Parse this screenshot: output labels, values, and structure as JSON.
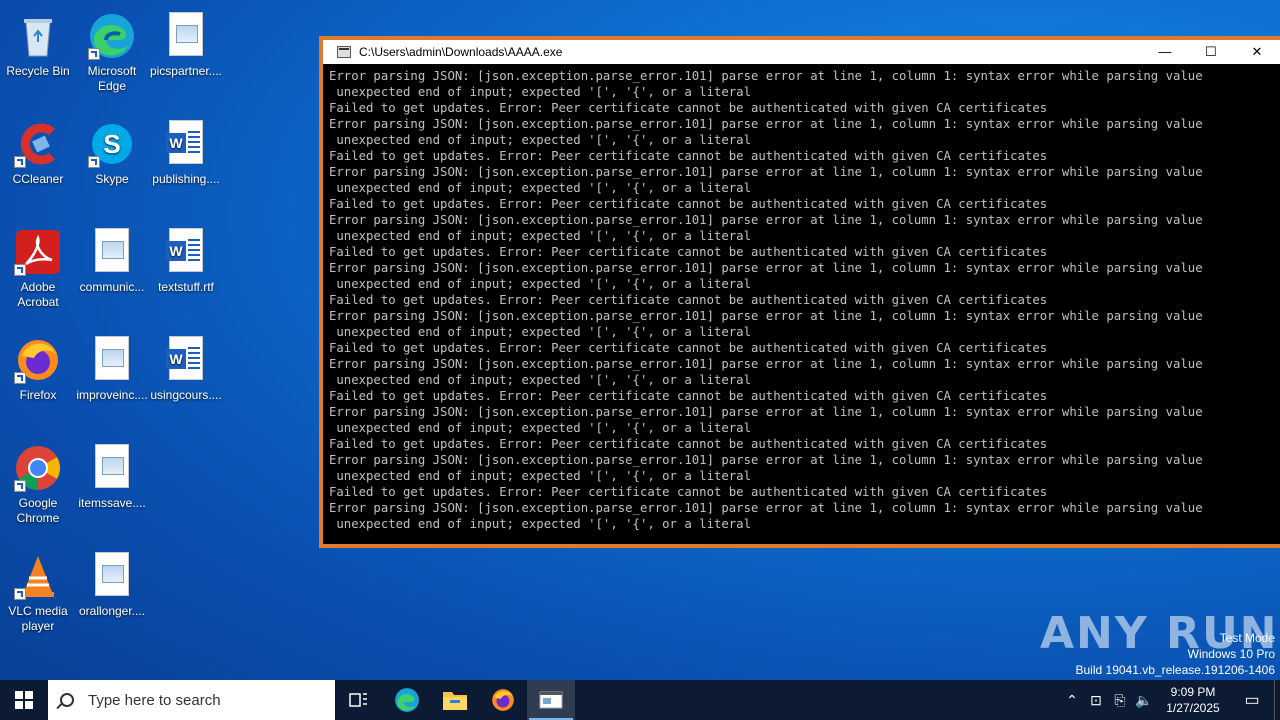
{
  "desktop": {
    "icons": [
      {
        "label": "Recycle Bin"
      },
      {
        "label": "Microsoft Edge"
      },
      {
        "label": "picspartner...."
      },
      {
        "label": "CCleaner"
      },
      {
        "label": "Skype"
      },
      {
        "label": "publishing...."
      },
      {
        "label": "Adobe Acrobat"
      },
      {
        "label": "communic..."
      },
      {
        "label": "textstuff.rtf"
      },
      {
        "label": "Firefox"
      },
      {
        "label": "improveinc...."
      },
      {
        "label": "usingcours...."
      },
      {
        "label": "Google Chrome"
      },
      {
        "label": "itemssave...."
      },
      {
        "label": "VLC media player"
      },
      {
        "label": "orallonger...."
      }
    ]
  },
  "console": {
    "title": "C:\\Users\\admin\\Downloads\\AAAA.exe",
    "minimize": "—",
    "maximize": "☐",
    "close": "✕",
    "lines": [
      "Error parsing JSON: [json.exception.parse_error.101] parse error at line 1, column 1: syntax error while parsing value",
      " unexpected end of input; expected '[', '{', or a literal",
      "Failed to get updates. Error: Peer certificate cannot be authenticated with given CA certificates",
      "Error parsing JSON: [json.exception.parse_error.101] parse error at line 1, column 1: syntax error while parsing value",
      " unexpected end of input; expected '[', '{', or a literal",
      "Failed to get updates. Error: Peer certificate cannot be authenticated with given CA certificates",
      "Error parsing JSON: [json.exception.parse_error.101] parse error at line 1, column 1: syntax error while parsing value",
      " unexpected end of input; expected '[', '{', or a literal",
      "Failed to get updates. Error: Peer certificate cannot be authenticated with given CA certificates",
      "Error parsing JSON: [json.exception.parse_error.101] parse error at line 1, column 1: syntax error while parsing value",
      " unexpected end of input; expected '[', '{', or a literal",
      "Failed to get updates. Error: Peer certificate cannot be authenticated with given CA certificates",
      "Error parsing JSON: [json.exception.parse_error.101] parse error at line 1, column 1: syntax error while parsing value",
      " unexpected end of input; expected '[', '{', or a literal",
      "Failed to get updates. Error: Peer certificate cannot be authenticated with given CA certificates",
      "Error parsing JSON: [json.exception.parse_error.101] parse error at line 1, column 1: syntax error while parsing value",
      " unexpected end of input; expected '[', '{', or a literal",
      "Failed to get updates. Error: Peer certificate cannot be authenticated with given CA certificates",
      "Error parsing JSON: [json.exception.parse_error.101] parse error at line 1, column 1: syntax error while parsing value",
      " unexpected end of input; expected '[', '{', or a literal",
      "Failed to get updates. Error: Peer certificate cannot be authenticated with given CA certificates",
      "Error parsing JSON: [json.exception.parse_error.101] parse error at line 1, column 1: syntax error while parsing value",
      " unexpected end of input; expected '[', '{', or a literal",
      "Failed to get updates. Error: Peer certificate cannot be authenticated with given CA certificates",
      "Error parsing JSON: [json.exception.parse_error.101] parse error at line 1, column 1: syntax error while parsing value",
      " unexpected end of input; expected '[', '{', or a literal",
      "Failed to get updates. Error: Peer certificate cannot be authenticated with given CA certificates",
      "Error parsing JSON: [json.exception.parse_error.101] parse error at line 1, column 1: syntax error while parsing value",
      " unexpected end of input; expected '[', '{', or a literal"
    ]
  },
  "watermark": {
    "brand": "ANY RUN",
    "line1": "Test Mode",
    "line2": "Windows 10 Pro",
    "line3": "Build 19041.vb_release.191206-1406"
  },
  "taskbar": {
    "search_placeholder": "Type here to search",
    "time": "9:09 PM",
    "date": "1/27/2025",
    "apps": [
      "task-view",
      "edge",
      "file-explorer",
      "firefox",
      "console"
    ]
  },
  "colors": {
    "accent_border": "#e07a2a",
    "taskbar": "#0c1a33"
  }
}
